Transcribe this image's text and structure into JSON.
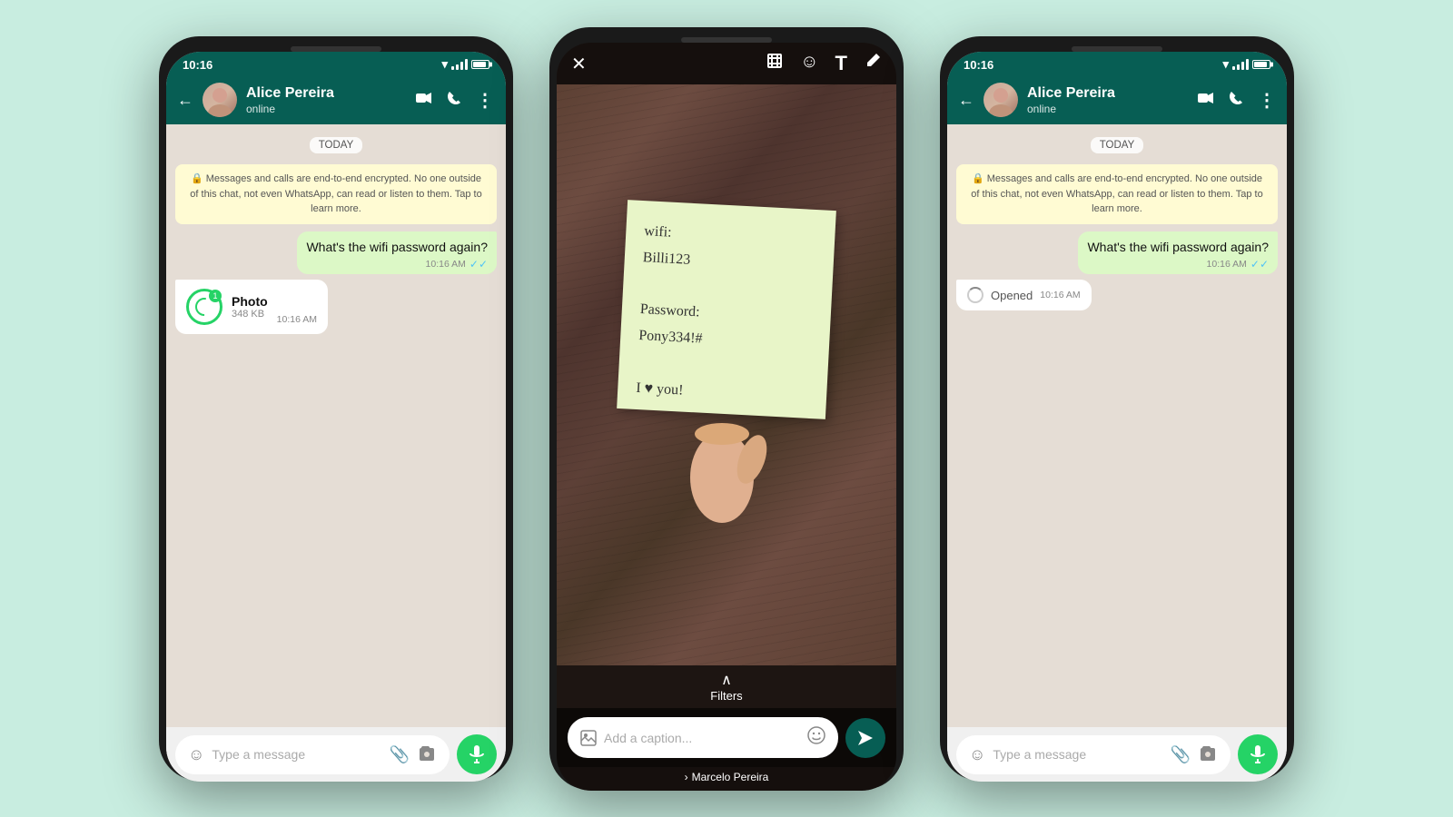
{
  "bg_color": "#c8ede0",
  "phones": {
    "left": {
      "status_bar": {
        "time": "10:16",
        "icons": [
          "wifi",
          "signal",
          "battery"
        ]
      },
      "header": {
        "contact_name": "Alice Pereira",
        "status": "online",
        "back_label": "←",
        "video_icon": "📹",
        "call_icon": "📞",
        "more_icon": "⋮"
      },
      "chat": {
        "date_badge": "TODAY",
        "encrypt_notice": "🔒 Messages and calls are end-to-end encrypted. No one outside of this chat, not even WhatsApp, can read or listen to them. Tap to learn more.",
        "messages": [
          {
            "type": "sent",
            "text": "What's the wifi password again?",
            "time": "10:16 AM",
            "ticks": "✓✓"
          },
          {
            "type": "photo",
            "label": "Photo",
            "size": "348 KB",
            "time": "10:16 AM"
          }
        ]
      },
      "input": {
        "placeholder": "Type a message",
        "emoji_icon": "☺",
        "attach_icon": "📎",
        "camera_icon": "📷",
        "mic_icon": "🎙"
      }
    },
    "middle": {
      "toolbar": {
        "close_icon": "✕",
        "crop_icon": "⊡",
        "emoji_icon": "☺",
        "text_icon": "T",
        "pen_icon": "✏"
      },
      "note_text": "wifi:\nBilli123\n\nPassword:\nPony334!#\n\nI ♥ you!",
      "filters_label": "Filters",
      "caption_placeholder": "Add a caption...",
      "send_icon": "➤",
      "recipient": "Marcelo Pereira"
    },
    "right": {
      "status_bar": {
        "time": "10:16"
      },
      "header": {
        "contact_name": "Alice Pereira",
        "status": "online",
        "back_label": "←"
      },
      "chat": {
        "date_badge": "TODAY",
        "encrypt_notice": "🔒 Messages and calls are end-to-end encrypted. No one outside of this chat, not even WhatsApp, can read or listen to them. Tap to learn more.",
        "messages": [
          {
            "type": "sent",
            "text": "What's the wifi password again?",
            "time": "10:16 AM",
            "ticks": "✓✓"
          },
          {
            "type": "opened",
            "text": "Opened",
            "time": "10:16 AM"
          }
        ]
      },
      "input": {
        "placeholder": "Type a message"
      }
    }
  }
}
